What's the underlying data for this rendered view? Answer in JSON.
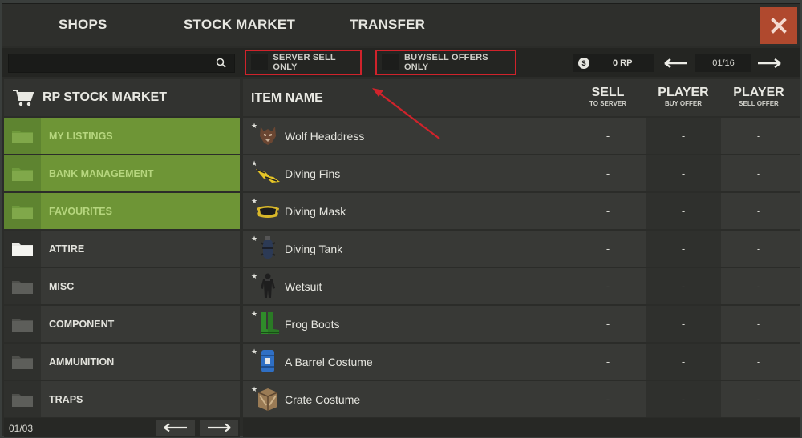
{
  "nav": {
    "tabs": [
      "SHOPS",
      "STOCK MARKET",
      "TRANSFER"
    ]
  },
  "toolbar": {
    "search_value": "",
    "filters": [
      "SERVER SELL ONLY",
      "BUY/SELL OFFERS ONLY"
    ],
    "balance": "0 RP",
    "balance_icon": "$",
    "page": "01/16"
  },
  "sidebar": {
    "title": "RP STOCK MARKET",
    "categories": [
      {
        "label": "MY LISTINGS",
        "active": true
      },
      {
        "label": "BANK MANAGEMENT",
        "active": true
      },
      {
        "label": "FAVOURITES",
        "active": true
      },
      {
        "label": "ATTIRE",
        "active": false
      },
      {
        "label": "MISC",
        "active": false
      },
      {
        "label": "COMPONENT",
        "active": false
      },
      {
        "label": "AMMUNITION",
        "active": false
      },
      {
        "label": "TRAPS",
        "active": false
      }
    ],
    "page": "01/03"
  },
  "table": {
    "headers": {
      "item": "ITEM NAME",
      "sell": {
        "main": "SELL",
        "sub": "TO SERVER"
      },
      "buy": {
        "main": "PLAYER",
        "sub": "BUY OFFER"
      },
      "sellOffer": {
        "main": "PLAYER",
        "sub": "SELL OFFER"
      }
    },
    "rows": [
      {
        "name": "Wolf Headdress",
        "icon": "wolf-headdress-icon",
        "sell": "-",
        "buy": "-",
        "sellOffer": "-"
      },
      {
        "name": "Diving Fins",
        "icon": "diving-fins-icon",
        "sell": "-",
        "buy": "-",
        "sellOffer": "-"
      },
      {
        "name": "Diving Mask",
        "icon": "diving-mask-icon",
        "sell": "-",
        "buy": "-",
        "sellOffer": "-"
      },
      {
        "name": "Diving Tank",
        "icon": "diving-tank-icon",
        "sell": "-",
        "buy": "-",
        "sellOffer": "-"
      },
      {
        "name": "Wetsuit",
        "icon": "wetsuit-icon",
        "sell": "-",
        "buy": "-",
        "sellOffer": "-"
      },
      {
        "name": "Frog Boots",
        "icon": "frog-boots-icon",
        "sell": "-",
        "buy": "-",
        "sellOffer": "-"
      },
      {
        "name": "A Barrel Costume",
        "icon": "barrel-costume-icon",
        "sell": "-",
        "buy": "-",
        "sellOffer": "-"
      },
      {
        "name": "Crate Costume",
        "icon": "crate-costume-icon",
        "sell": "-",
        "buy": "-",
        "sellOffer": "-"
      }
    ]
  },
  "colors": {
    "accent_active": "#6e9536",
    "highlight_box": "#d0232b",
    "close": "#b0492e"
  }
}
